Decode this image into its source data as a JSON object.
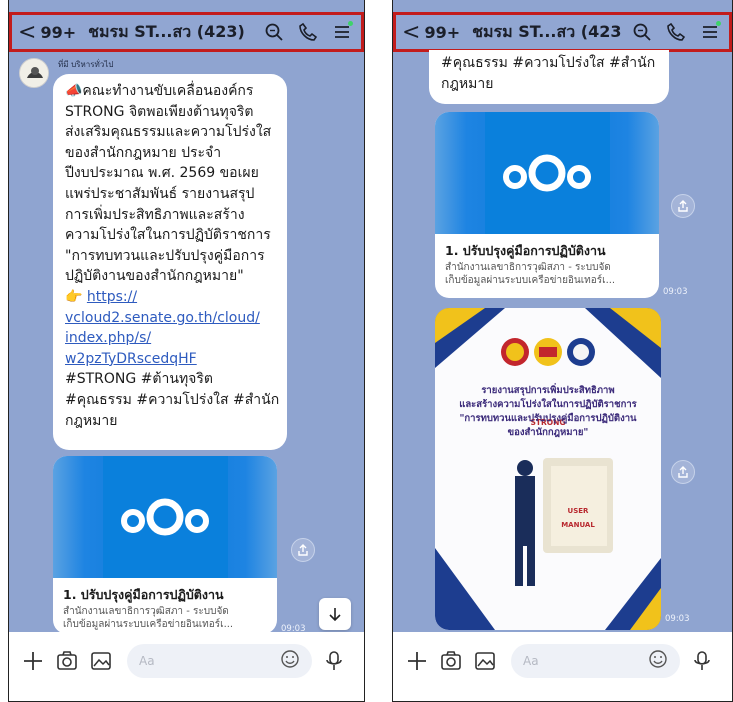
{
  "header": {
    "back_glyph": "<",
    "unread": "99+",
    "title": "ชมรม ST...สว (423)",
    "icons": [
      "search-icon",
      "phone-icon",
      "menu-icon"
    ],
    "online_dot_color": "#3ed36a"
  },
  "frame_highlight_color": "#c21c1c",
  "chat_bg_color": "#8fa4d0",
  "left": {
    "sender": "ที่มี บริหารทั่วไป",
    "message_lines": [
      "📣คณะทำงานขับเคลื่อนองค์กร",
      "STRONG จิตพอเพียงต้านทุจริต",
      "ส่งเสริมคุณธรรมและความโปร่งใส",
      "ของสำนักกฎหมาย ประจำ",
      "ปีงบประมาณ พ.ศ. 2569 ขอเผย",
      "แพร่ประชาสัมพันธ์ รายงานสรุป",
      "การเพิ่มประสิทธิภาพและสร้าง",
      "ความโปร่งใสในการปฏิบัติราชการ",
      "\"การทบทวนและปรับปรุงคู่มือการ",
      "ปฏิบัติงานของสำนักกฎหมาย\""
    ],
    "link_prefix": "👉",
    "link_lines": [
      "https://",
      "vcloud2.senate.go.th/cloud/",
      "index.php/s/",
      "w2pzTyDRscedqHF"
    ],
    "tail_lines": [
      "#STRONG #ต้านทุจริต",
      "#คุณธรรม #ความโปร่งใส #สำนัก",
      "กฎหมาย"
    ],
    "card": {
      "title": "1. ปรับปรุงคู่มือการปฏิบัติงาน",
      "subtitle1": "สำนักงานเลขาธิการวุฒิสภา - ระบบจัด",
      "subtitle2": "เก็บข้อมูลผ่านระบบเครือข่ายอินเทอร์เ...",
      "time": "09:03"
    }
  },
  "right": {
    "top_lines": [
      "#คุณธรรม #ความโปร่งใส #สำนัก",
      "กฎหมาย"
    ],
    "card": {
      "title": "1. ปรับปรุงคู่มือการปฏิบัติงาน",
      "subtitle1": "สำนักงานเลขาธิการวุฒิสภา - ระบบจัด",
      "subtitle2": "เก็บข้อมูลผ่านระบบเครือข่ายอินเทอร์เ...",
      "time": "09:03"
    },
    "report": {
      "lines": [
        "รายงานสรุปการเพิ่มประสิทธิภาพ",
        "และสร้างความโปร่งใสในการปฏิบัติราชการ",
        "\"การทบทวนและปรับปรุงคู่มือการปฏิบัติงาน",
        "ของสำนักกฎหมาย\""
      ],
      "badge": "STRONG",
      "book": "USER MANUAL",
      "time": "09:03"
    }
  },
  "input": {
    "placeholder": "Aa",
    "icons": [
      "plus-icon",
      "camera-icon",
      "image-icon",
      "emoji-icon",
      "mic-icon"
    ]
  }
}
